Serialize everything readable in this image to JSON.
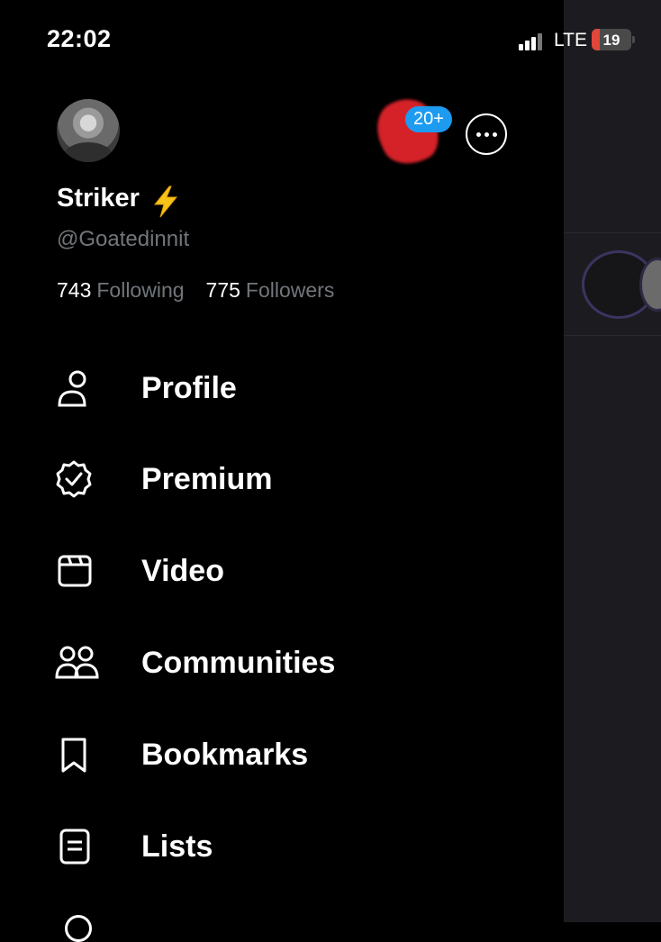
{
  "status_bar": {
    "time": "22:02",
    "network": "LTE",
    "battery": "19"
  },
  "profile": {
    "name": "Striker",
    "handle": "@Goatedinnit",
    "following_count": "743",
    "following_label": "Following",
    "followers_count": "775",
    "followers_label": "Followers",
    "notification_badge": "20+"
  },
  "menu": [
    {
      "label": "Profile",
      "icon": "person-icon"
    },
    {
      "label": "Premium",
      "icon": "verified-badge-icon"
    },
    {
      "label": "Video",
      "icon": "video-clapper-icon"
    },
    {
      "label": "Communities",
      "icon": "communities-icon"
    },
    {
      "label": "Bookmarks",
      "icon": "bookmark-icon"
    },
    {
      "label": "Lists",
      "icon": "list-icon"
    }
  ],
  "colors": {
    "background": "#000000",
    "muted_text": "#71767b",
    "accent": "#1d9bf0",
    "battery_low": "#e0463a"
  }
}
